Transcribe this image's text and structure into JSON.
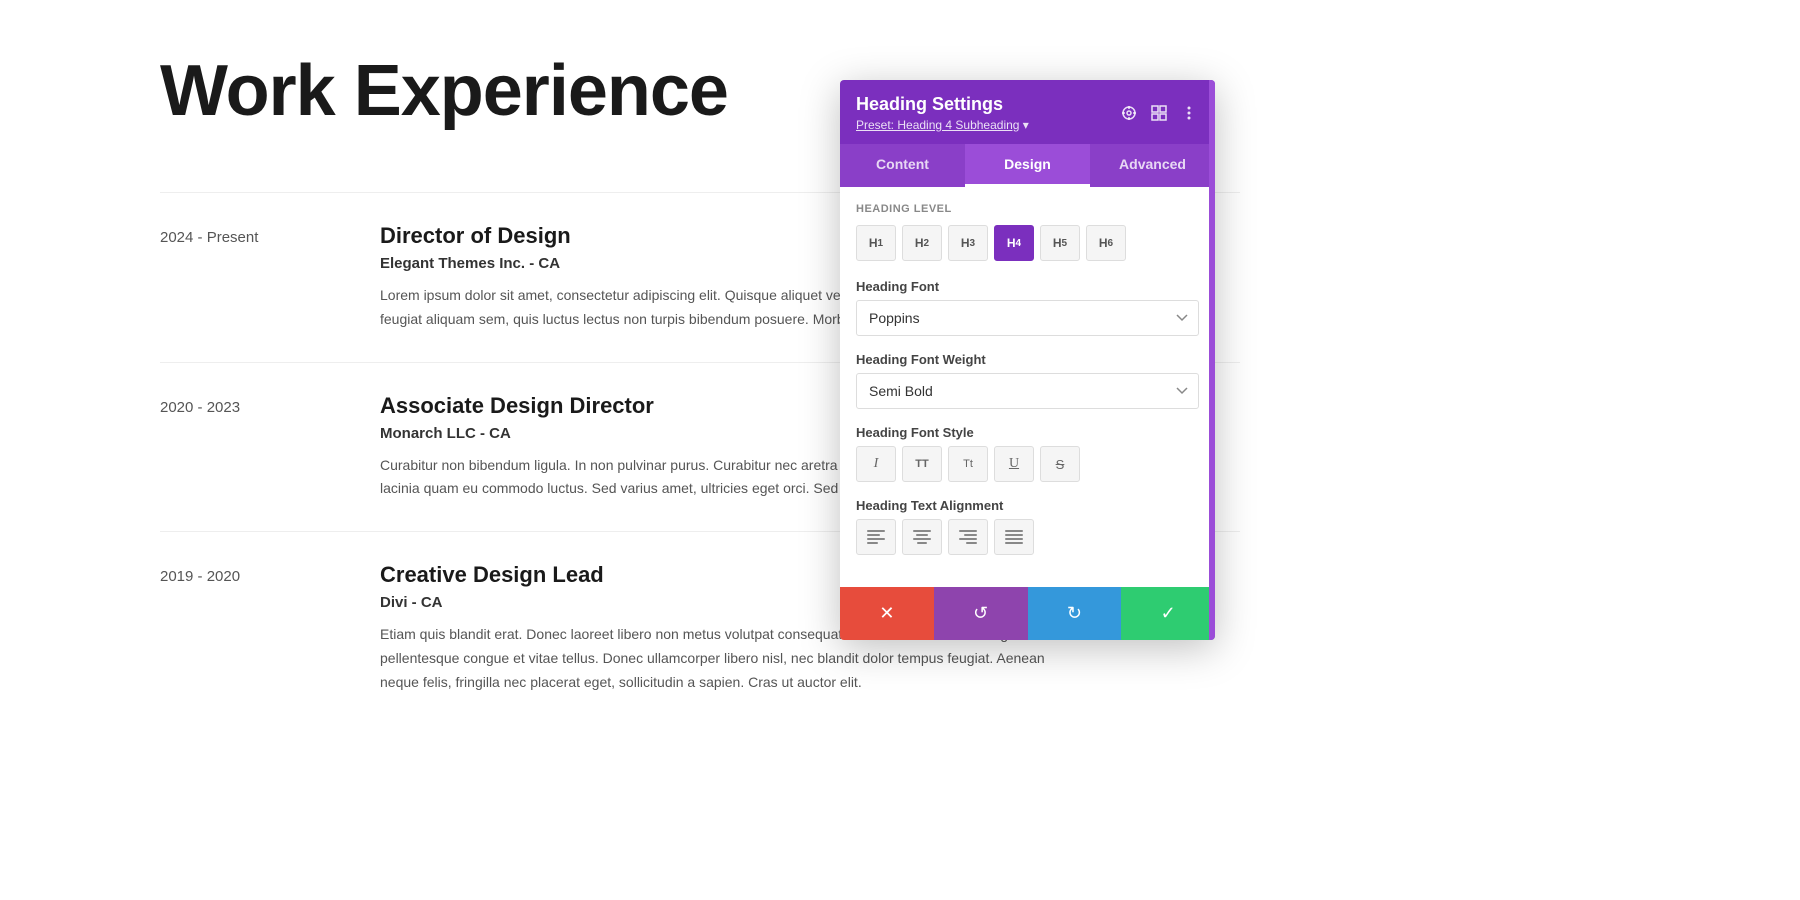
{
  "page": {
    "title": "Work Experience"
  },
  "work_entries": [
    {
      "years": "2024 - Present",
      "title": "Director of Design",
      "company": "Elegant Themes Inc. - CA",
      "description": "Lorem ipsum dolor sit amet, consectetur adipiscing elit. Quisque aliquet velit sit amet sem interdum faucibus. In feugiat aliquam sem, quis luctus lectus non turpis bibendum posuere. Morbi tortor nisl, egestas nisl."
    },
    {
      "years": "2020 - 2023",
      "title": "Associate Design Director",
      "company": "Monarch LLC - CA",
      "description": "Curabitur non bibendum ligula. In non pulvinar purus. Curabitur nec aretra elit. Fusce ut mauris quam. Quisque lacinia quam eu commodo luctus. Sed varius amet, ultricies eget orci. Sed vitae nulla et justo pellentesque."
    },
    {
      "years": "2019 - 2020",
      "title": "Creative Design Lead",
      "company": "Divi - CA",
      "description": "Etiam quis blandit erat. Donec laoreet libero non metus volutpat consequat in vel metus. Sed non augue id felis pellentesque congue et vitae tellus. Donec ullamcorper libero nisl, nec blandit dolor tempus feugiat. Aenean neque felis, fringilla nec placerat eget, sollicitudin a sapien. Cras ut auctor elit."
    }
  ],
  "panel": {
    "title": "Heading Settings",
    "preset_label": "Preset: Heading 4 Subheading",
    "tabs": [
      {
        "id": "content",
        "label": "Content"
      },
      {
        "id": "design",
        "label": "Design",
        "active": true
      },
      {
        "id": "advanced",
        "label": "Advanced"
      }
    ],
    "heading_level_label": "Heading Level",
    "heading_levels": [
      "H1",
      "H2",
      "H3",
      "H4",
      "H5",
      "H6"
    ],
    "active_heading_level": "H4",
    "heading_font_label": "Heading Font",
    "heading_font_value": "Poppins",
    "heading_font_weight_label": "Heading Font Weight",
    "heading_font_weight_value": "Semi Bold",
    "heading_font_style_label": "Heading Font Style",
    "heading_text_alignment_label": "Heading Text Alignment",
    "style_buttons": [
      {
        "id": "italic",
        "label": "I"
      },
      {
        "id": "bold",
        "label": "TT"
      },
      {
        "id": "uppercase",
        "label": "Tt"
      },
      {
        "id": "underline",
        "label": "U"
      },
      {
        "id": "strikethrough",
        "label": "S"
      }
    ],
    "actions": {
      "cancel": "✕",
      "undo": "↺",
      "redo": "↻",
      "confirm": "✓"
    },
    "header_icons": [
      "target-icon",
      "grid-icon",
      "more-icon"
    ]
  }
}
